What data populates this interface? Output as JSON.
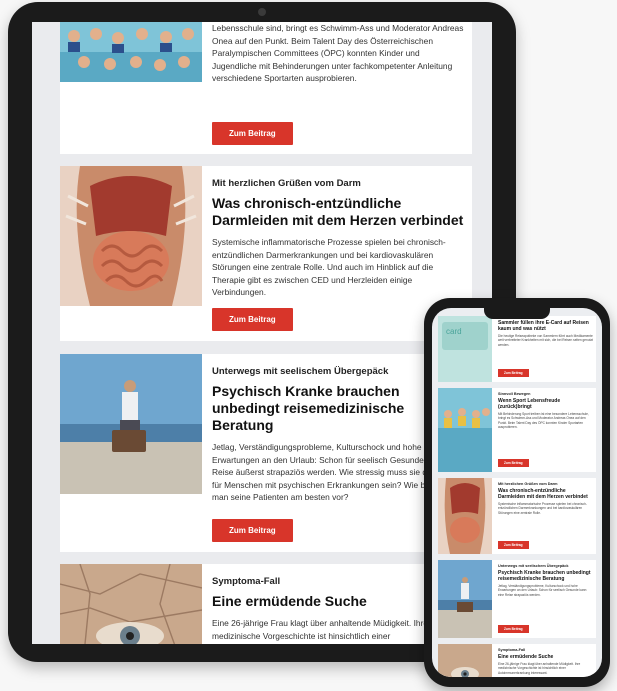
{
  "colors": {
    "accent": "#d8352a",
    "card": "#ffffff",
    "screen_bg": "#eaebee",
    "device": "#1b1b1b"
  },
  "tablet": {
    "article1": {
      "text": "Lebensschule sind, bringt es Schwimm-Ass und Moderator Andreas Onea auf den Punkt. Beim Talent Day des Österreichischen Paralympischen Committees (ÖPC) konnten Kinder und Jugendliche mit Behinderungen unter fachkompetenter Anleitung verschiedene Sportarten ausprobieren.",
      "button": "Zum Beitrag"
    },
    "article2": {
      "kicker": "Mit herzlichen Grüßen vom Darm",
      "title": "Was chronisch-entzündliche Darmleiden mit dem Herzen verbindet",
      "text": "Systemische inflammatorische Prozesse spielen bei chronisch-entzündlichen Darmerkrankungen und bei kardiovaskulären Störungen eine zentrale Rolle. Und auch im Hinblick auf die Therapie gibt es zwischen CED und Herzleiden einige Verbindungen.",
      "button": "Zum Beitrag"
    },
    "article3": {
      "kicker": "Unterwegs mit seelischem Übergepäck",
      "title": "Psychisch Kranke brauchen unbedingt reisemedizinische Beratung",
      "text": "Jetlag, Verständigungsprobleme, Kulturschock und hohe Erwartungen an den Urlaub: Schon für seelisch Gesunde kann eine Reise äußerst strapaziös werden. Wie stressig muss sie dann erst für Menschen mit psychischen Erkrankungen sein? Wie bereitet man seine Patienten am besten vor?",
      "button": "Zum Beitrag"
    },
    "article4": {
      "kicker": "Symptoma-Fall",
      "title": "Eine ermüdende Suche",
      "text": "Eine 26-jährige Frau klagt über anhaltende Müdigkeit. Ihre medizinische Vorgeschichte ist hinsichtlich einer"
    }
  },
  "phone": {
    "items": [
      {
        "kicker": "",
        "title": "Sammler füllen ihre E-Card auf Reisen kaum und was nützt",
        "text": "Die heutige Reiseapotheke von Sammlern führt auch Medikamente weit verbreiteter Krankheiten mit sich, die bei Reisen selten genutzt werden.",
        "button": "Zum Beitrag",
        "thumb": "card"
      },
      {
        "kicker": "Sinnvoll Bewegen",
        "title": "Wenn Sport Lebensfreude (zurück)bringt",
        "text": "Mit Behinderung Sport treiben ist eine besondere Lebensschule, bringt es Schwimm-Ass und Moderator Andreas Onea auf den Punkt. Beim Talent Day des ÖPC konnten Kinder Sportarten ausprobieren.",
        "button": "Zum Beitrag",
        "thumb": "pool"
      },
      {
        "kicker": "Mit herzlichen Grüßen vom Darm",
        "title": "Was chronisch-entzündliche Darmleiden mit dem Herzen verbindet",
        "text": "Systemische inflammatorische Prozesse spielen bei chronisch-entzündlichen Darmerkrankungen und bei kardiovaskulären Störungen eine zentrale Rolle.",
        "button": "Zum Beitrag",
        "thumb": "gut"
      },
      {
        "kicker": "Unterwegs mit seelischem Übergepäck",
        "title": "Psychisch Kranke brauchen unbedingt reisemedizinische Beratung",
        "text": "Jetlag, Verständigungsprobleme, Kulturschock und hohe Erwartungen an den Urlaub: Schon für seelisch Gesunde kann eine Reise strapaziös werden.",
        "button": "Zum Beitrag",
        "thumb": "travel"
      },
      {
        "kicker": "Symptoma-Fall",
        "title": "Eine ermüdende Suche",
        "text": "Eine 26-jährige Frau klagt über anhaltende Müdigkeit. Ihre medizinische Vorgeschichte ist hinsichtlich einer Autoimmunerkrankung interessant.",
        "button": "",
        "thumb": "eye"
      }
    ]
  }
}
